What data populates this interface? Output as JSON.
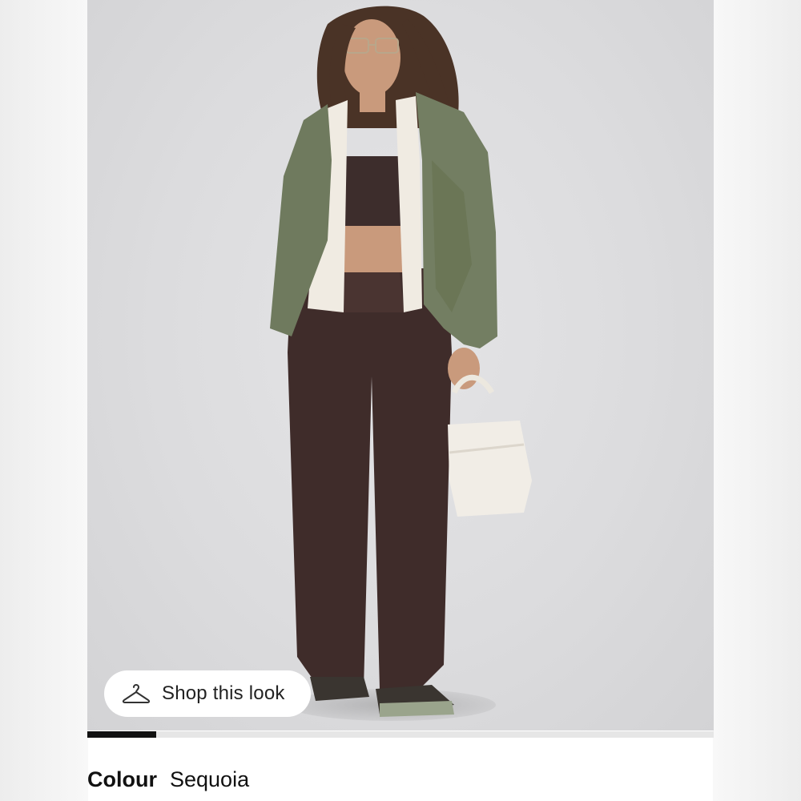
{
  "product_gallery": {
    "image_alt_subject": "model-in-olive-jacket-and-brown-wide-leg-pants",
    "progress_fraction": 0.11,
    "wishlist_icon": "heart-outline-icon",
    "next_icon": "chevron-right-icon"
  },
  "shop_look": {
    "label": "Shop this look",
    "icon": "hanger-icon"
  },
  "colour": {
    "label": "Colour",
    "value": "Sequoia"
  },
  "colors": {
    "jacket": "#6f7a5e",
    "pants": "#3f2c2a",
    "background": "#dedee0",
    "progress": "#111111"
  }
}
